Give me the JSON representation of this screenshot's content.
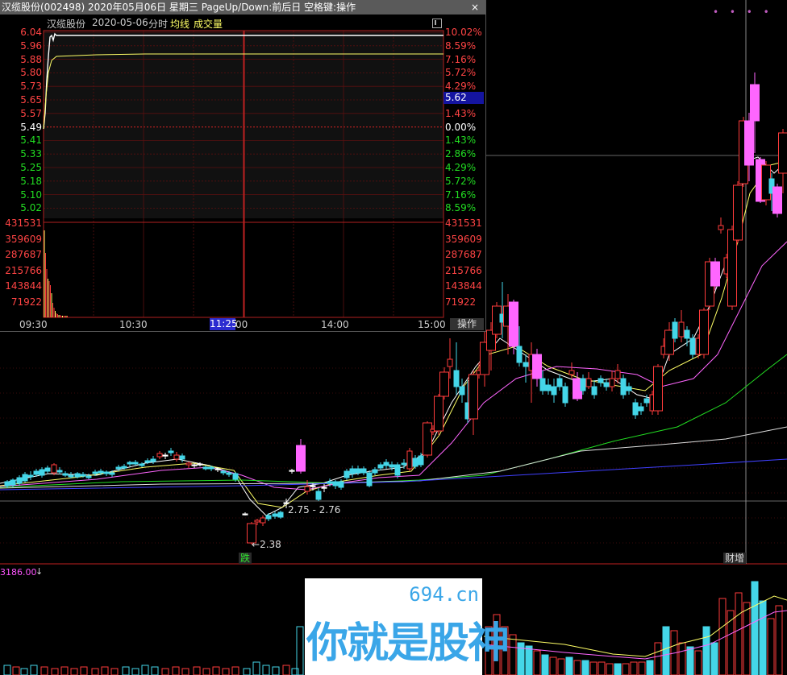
{
  "popup": {
    "title": "汉缆股份(002498) 2020年05月06日 星期三 PageUp/Down:前后日 空格键:操作",
    "close_label": "×",
    "header": {
      "name": "汉缆股份",
      "date": "2020-05-06",
      "mode": "分时",
      "avg_label": "均线",
      "vol_label": "成交量"
    },
    "price_labels": [
      "6.04",
      "5.96",
      "5.88",
      "5.80",
      "5.73",
      "5.65",
      "5.57",
      "5.49",
      "5.41",
      "5.33",
      "5.25",
      "5.18",
      "5.10",
      "5.02"
    ],
    "pct_labels": [
      "10.02%",
      "8.59%",
      "7.16%",
      "5.72%",
      "4.29%",
      "2.86%",
      "1.43%",
      "0.00%",
      "1.43%",
      "2.86%",
      "4.29%",
      "5.72%",
      "7.16%",
      "8.59%"
    ],
    "volume_labels": [
      "431531",
      "359609",
      "287687",
      "215766",
      "143844",
      "71922"
    ],
    "current_price": "5.62",
    "time_labels": [
      "09:30",
      "10:30",
      "11:25",
      "00",
      "14:00",
      "15:00"
    ],
    "op_label": "操作",
    "colors": {
      "up": "#ff3b3b",
      "down": "#00e000",
      "flat": "#ffffff",
      "avg": "#ffff66"
    }
  },
  "annotations": {
    "low_price": "2.38",
    "range": "2.75 - 2.76",
    "tag_left": "跌",
    "tag_right": "财增"
  },
  "volume_panel": {
    "label": "3186.00",
    "arrow": "↓"
  },
  "watermark": {
    "url": "694.cn",
    "text": "你就是股神"
  }
}
